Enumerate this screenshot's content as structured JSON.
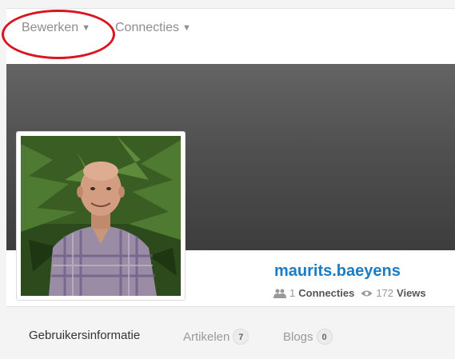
{
  "menu": {
    "edit_label": "Bewerken",
    "connections_label": "Connecties"
  },
  "profile": {
    "username": "maurits.baeyens",
    "connections_count": "1",
    "connections_label": "Connecties",
    "views_count": "172",
    "views_label": "Views"
  },
  "tabs": [
    {
      "label": "Gebruikersinformatie"
    },
    {
      "label": "Artikelen",
      "badge": "7"
    },
    {
      "label": "Blogs",
      "badge": "0"
    }
  ],
  "icons": {
    "connections": "users-icon",
    "views": "eye-icon",
    "dropdown": "caret-down-icon"
  },
  "colors": {
    "link": "#1b7cc6",
    "highlight": "#d9151d"
  }
}
